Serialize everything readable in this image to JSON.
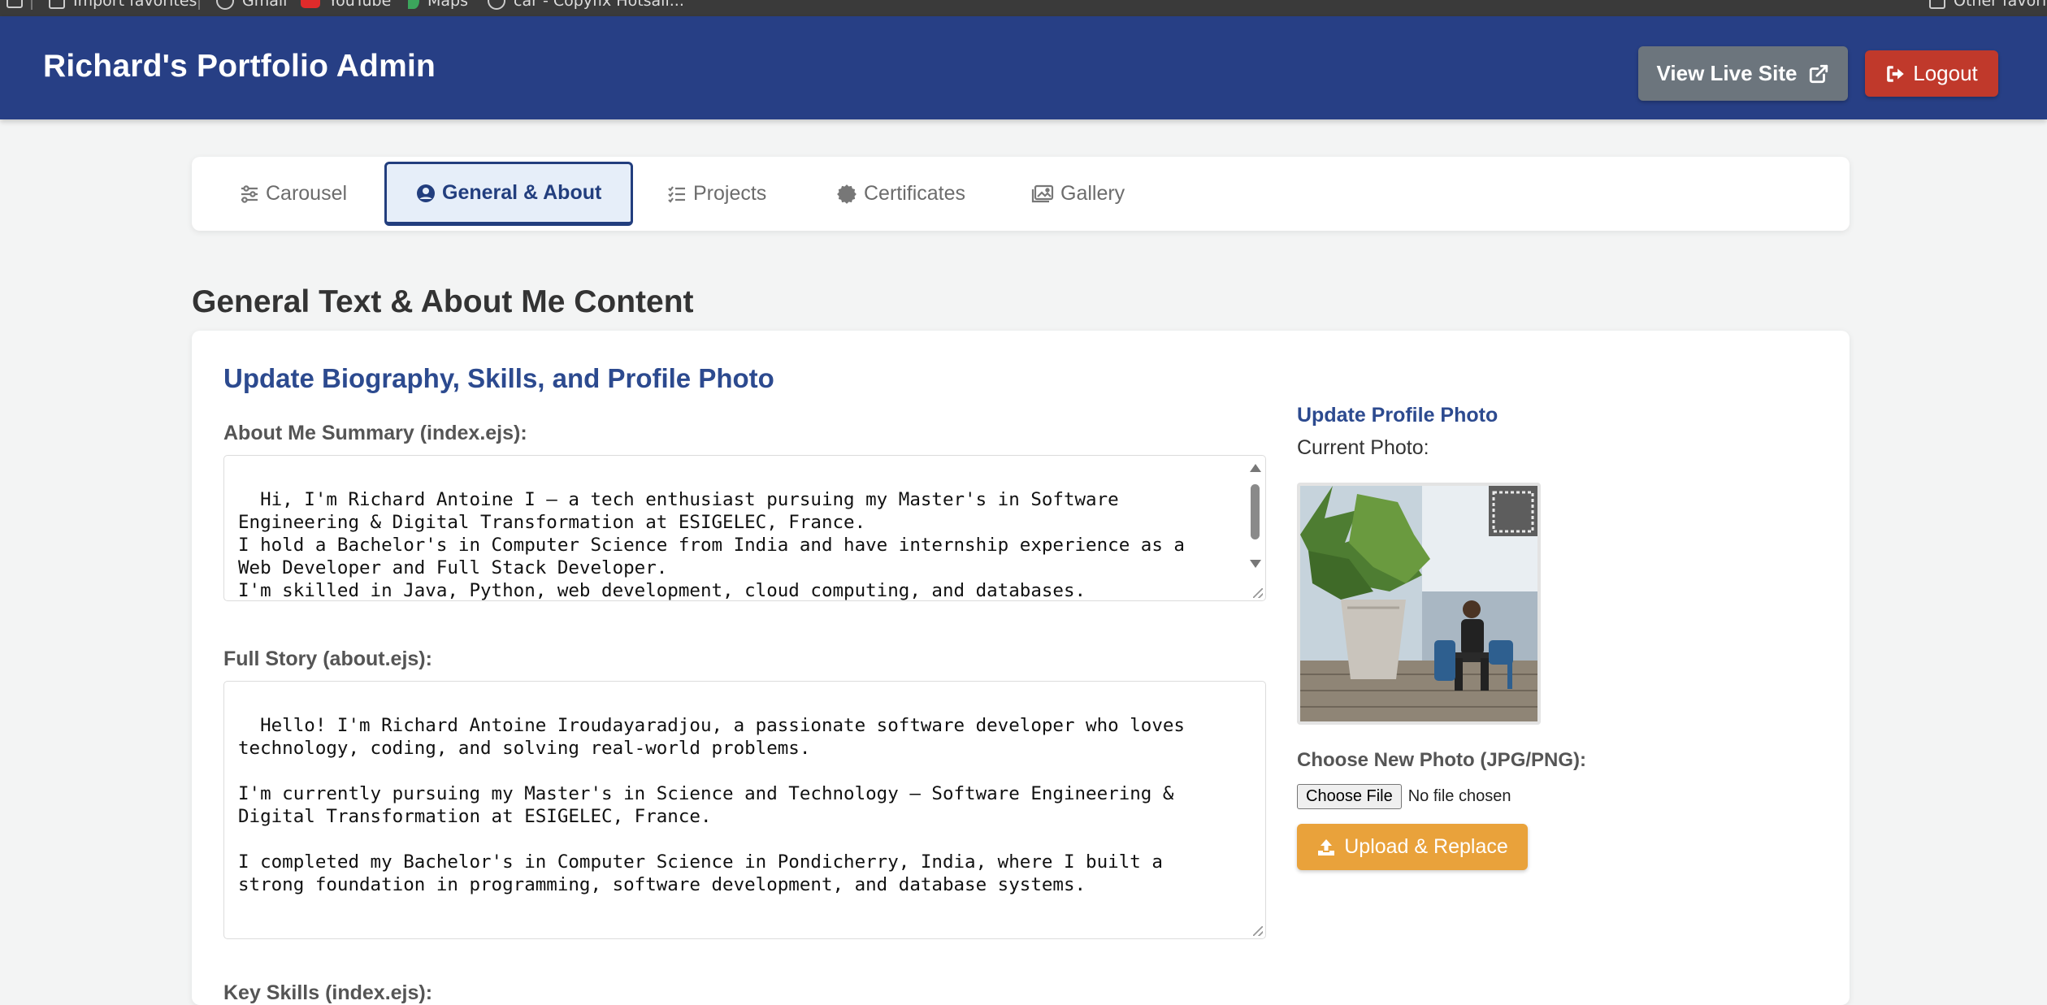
{
  "browser": {
    "bookmarks": [
      "Import favorites",
      "Gmail",
      "YouTube",
      "Maps",
      "car - Copyfix Hotsail..."
    ],
    "other": "Other favorites"
  },
  "header": {
    "brand": "Richard's Portfolio Admin",
    "view_live": "View Live Site",
    "logout": "Logout",
    "colors": {
      "bar": "#273f85",
      "view_live": "#6c757d",
      "logout": "#c0392b"
    }
  },
  "tabs": [
    {
      "label": "Carousel",
      "icon": "sliders-icon",
      "active": false
    },
    {
      "label": "General & About",
      "icon": "user-circle-icon",
      "active": true
    },
    {
      "label": "Projects",
      "icon": "tasks-icon",
      "active": false
    },
    {
      "label": "Certificates",
      "icon": "certificate-icon",
      "active": false
    },
    {
      "label": "Gallery",
      "icon": "images-icon",
      "active": false
    }
  ],
  "page": {
    "title": "General Text & About Me Content",
    "card_title": "Update Biography, Skills, and Profile Photo"
  },
  "about_summary": {
    "label": "About Me Summary (index.ejs):",
    "value": "Hi, I'm Richard Antoine I — a tech enthusiast pursuing my Master's in Software Engineering & Digital Transformation at ESIGELEC, France.\nI hold a Bachelor's in Computer Science from India and have internship experience as a Web Developer and Full Stack Developer.\nI'm skilled in Java, Python, web development, cloud computing, and databases.\nClick below to know more about me 👇"
  },
  "full_story": {
    "label": "Full Story (about.ejs):",
    "value": "Hello! I'm Richard Antoine Iroudayaradjou, a passionate software developer who loves technology, coding, and solving real-world problems.\n\nI'm currently pursuing my Master's in Science and Technology – Software Engineering & Digital Transformation at ESIGELEC, France.\n\nI completed my Bachelor's in Computer Science in Pondicherry, India, where I built a strong foundation in programming, software development, and database systems."
  },
  "profile_photo": {
    "title": "Update Profile Photo",
    "current_label": "Current Photo:",
    "choose_label": "Choose New Photo (JPG/PNG):",
    "choose_button": "Choose File",
    "no_file": "No file chosen",
    "upload_button": "Upload & Replace",
    "upload_color": "#e9a23b"
  },
  "next_field": {
    "label": "Key Skills (index.ejs):"
  }
}
